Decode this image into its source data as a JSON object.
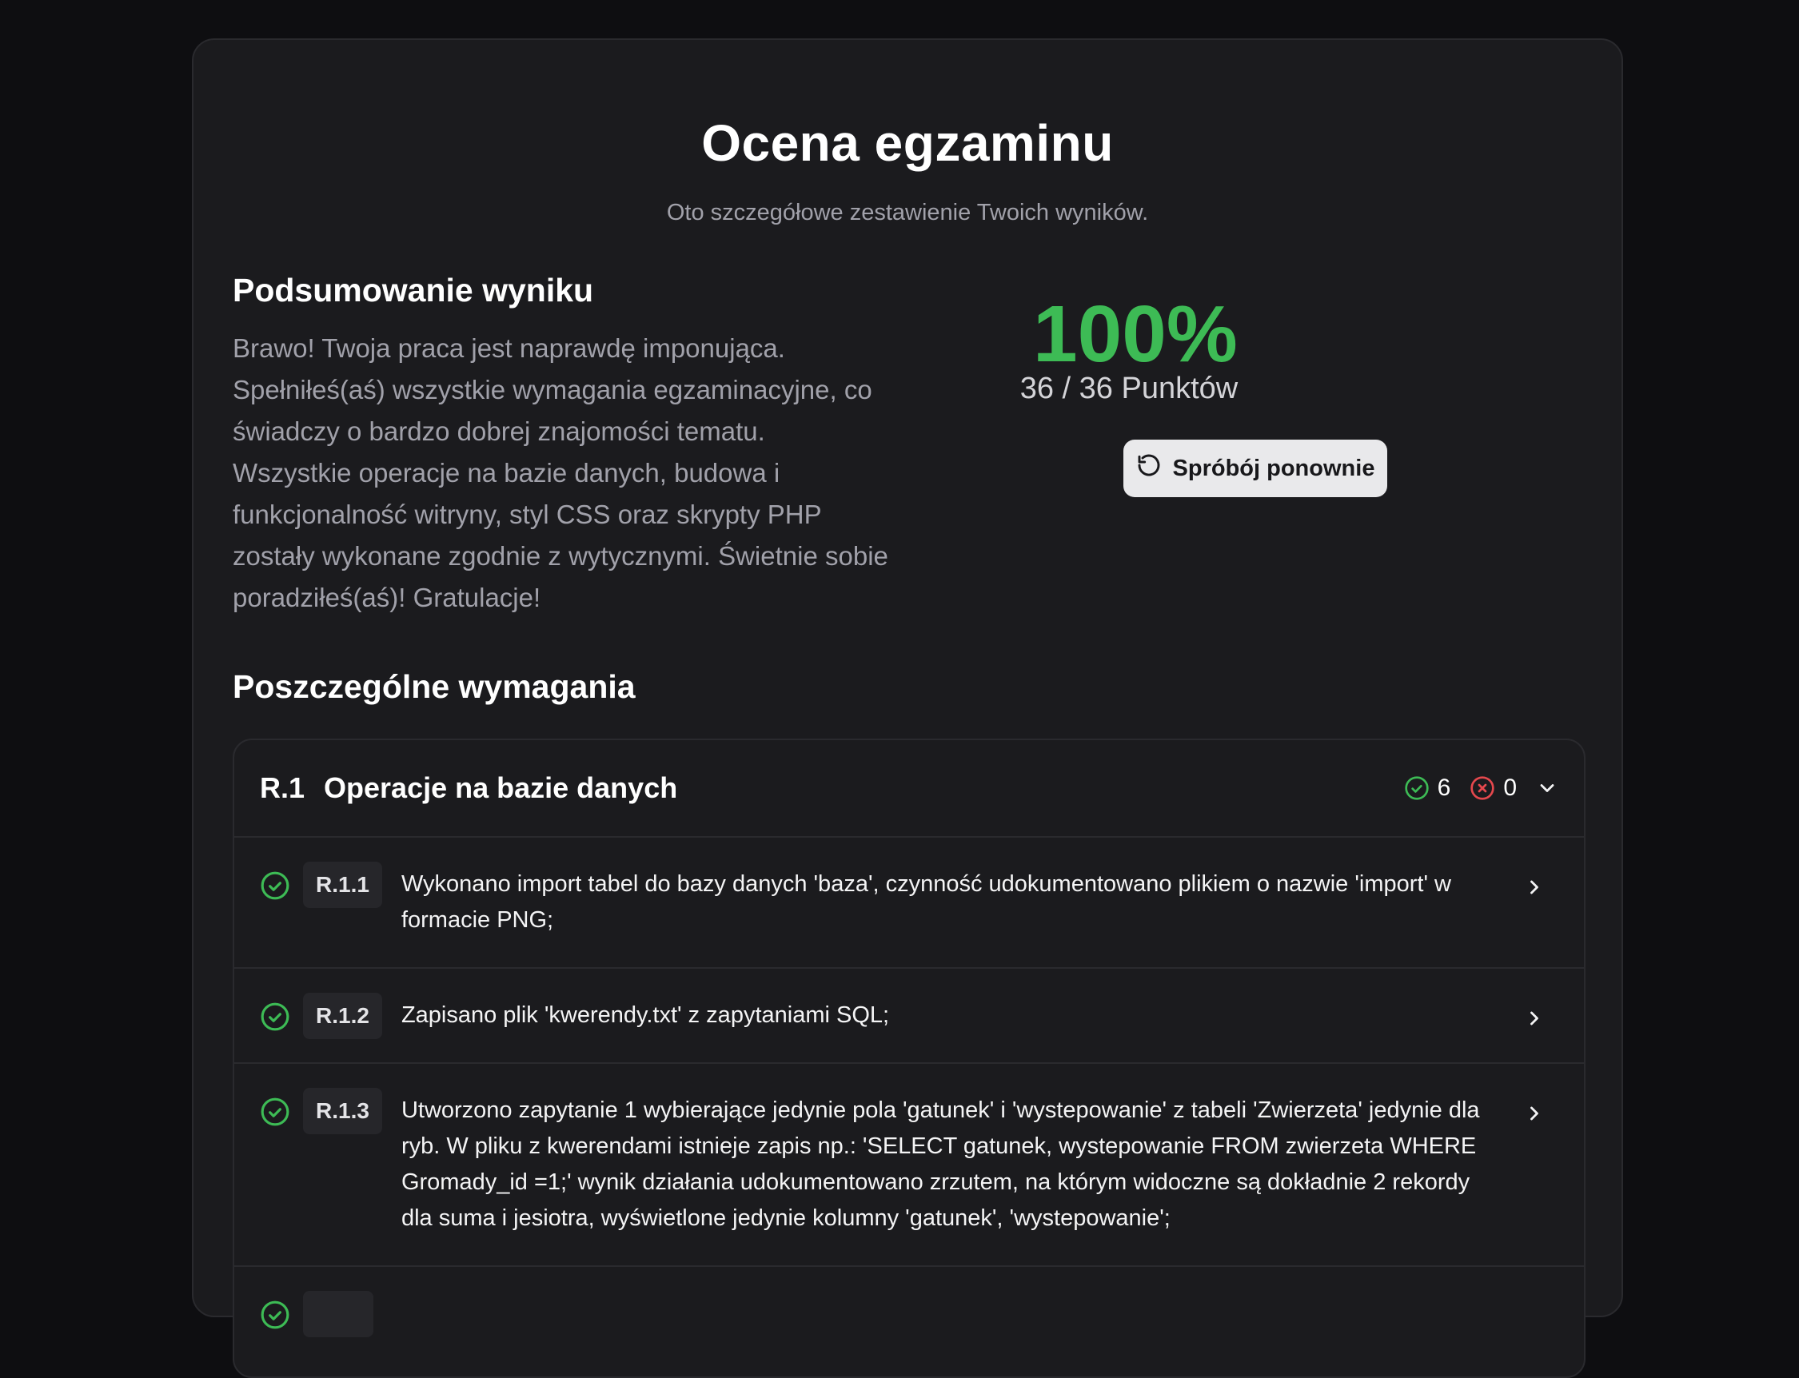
{
  "header": {
    "title": "Ocena egzaminu",
    "subtitle": "Oto szczegółowe zestawienie Twoich wyników."
  },
  "summary": {
    "title": "Podsumowanie wyniku",
    "text": "Brawo! Twoja praca jest naprawdę imponująca. Spełniłeś(aś) wszystkie wymagania egzaminacyjne, co świadczy o bardzo dobrej znajomości tematu. Wszystkie operacje na bazie danych, budowa i funkcjonalność witryny, styl CSS oraz skrypty PHP zostały wykonane zgodnie z wytycznymi. Świetnie sobie poradziłeś(aś)! Gratulacje!"
  },
  "score": {
    "percent": "100%",
    "points": "36 / 36 Punktów",
    "retry_label": "Spróbój ponownie"
  },
  "requirements": {
    "title": "Poszczególne wymagania",
    "section": {
      "code": "R.1",
      "name": "Operacje na bazie danych",
      "passed": "6",
      "failed": "0",
      "items": [
        {
          "code": "R.1.1",
          "text": "Wykonano import tabel do bazy danych 'baza', czynność udokumentowano plikiem o nazwie 'import' w formacie PNG;"
        },
        {
          "code": "R.1.2",
          "text": "Zapisano plik 'kwerendy.txt' z zapytaniami SQL;"
        },
        {
          "code": "R.1.3",
          "text": "Utworzono zapytanie 1 wybierające jedynie pola 'gatunek' i 'wystepowanie' z tabeli 'Zwierzeta' jedynie dla ryb. W pliku z kwerendami istnieje zapis np.: 'SELECT gatunek, wystepowanie FROM zwierzeta WHERE Gromady_id =1;' wynik działania udokumentowano zrzutem, na którym widoczne są dokładnie 2 rekordy dla suma i jesiotra, wyświetlone jedynie kolumny 'gatunek', 'wystepowanie';"
        }
      ]
    }
  },
  "colors": {
    "accent_green": "#3dbb55",
    "error_red": "#e5484d"
  }
}
